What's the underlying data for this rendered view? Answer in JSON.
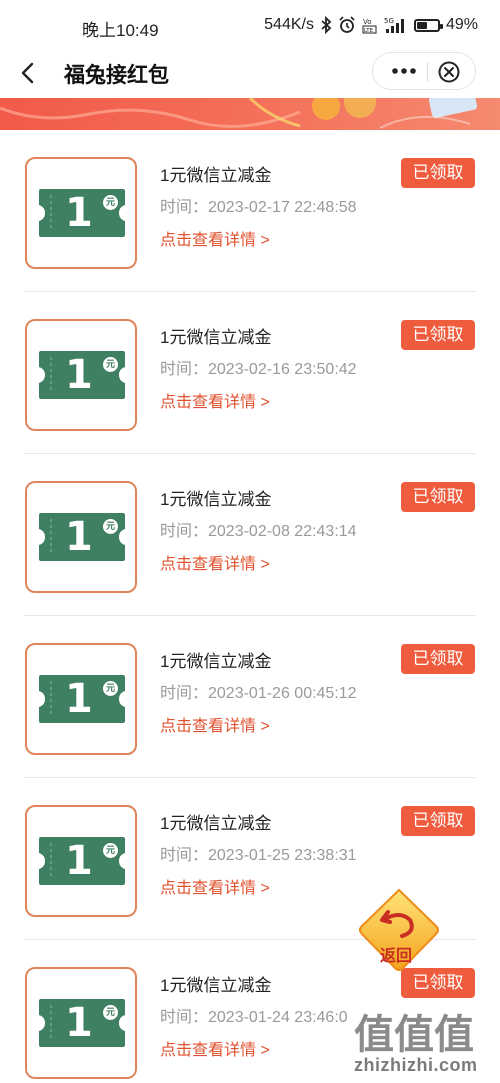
{
  "status_bar": {
    "time": "晚上10:49",
    "net_speed": "544K/s",
    "battery_text": "49%",
    "battery_level": 0.49
  },
  "header": {
    "back_icon": "chevron-left-icon",
    "title": "福兔接红包",
    "more_icon": "more-dots-icon",
    "close_icon": "close-circle-icon"
  },
  "coupon_thumb": {
    "amount": "1",
    "unit": "元"
  },
  "items": [
    {
      "name": "1元微信立减金",
      "time": "时间：2023-02-17 22:48:58",
      "detail": "点击查看详情 >",
      "status": "已领取"
    },
    {
      "name": "1元微信立减金",
      "time": "时间：2023-02-16 23:50:42",
      "detail": "点击查看详情 >",
      "status": "已领取"
    },
    {
      "name": "1元微信立减金",
      "time": "时间：2023-02-08 22:43:14",
      "detail": "点击查看详情 >",
      "status": "已领取"
    },
    {
      "name": "1元微信立减金",
      "time": "时间：2023-01-26 00:45:12",
      "detail": "点击查看详情 >",
      "status": "已领取"
    },
    {
      "name": "1元微信立减金",
      "time": "时间：2023-01-25 23:38:31",
      "detail": "点击查看详情 >",
      "status": "已领取"
    },
    {
      "name": "1元微信立减金",
      "time": "时间：2023-01-24 23:46:0",
      "detail": "点击查看详情 >",
      "status": "已领取"
    }
  ],
  "floating": {
    "return_label": "返回"
  },
  "watermark": {
    "text": "zhizhizhi.com",
    "glyphs": "值值值"
  },
  "colors": {
    "accent": "#ee5c3d",
    "detail_link": "#e1512f",
    "thumb_border": "#e0845a",
    "coupon_green": "#3f7f62",
    "banner": "#f25a4b"
  }
}
